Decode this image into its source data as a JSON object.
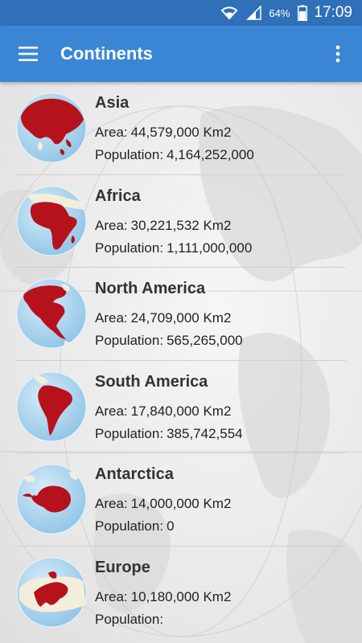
{
  "status_bar": {
    "battery": "64%",
    "time": "17:09",
    "icons": [
      "wifi-icon",
      "signal-icon",
      "battery-icon"
    ]
  },
  "app_bar": {
    "title": "Continents",
    "menu_icon": "hamburger-menu-icon",
    "overflow_icon": "more-vertical-icon",
    "color": "#3a86d4"
  },
  "labels": {
    "area": "Area:",
    "population": "Population:"
  },
  "continents": [
    {
      "name": "Asia",
      "area": "44,579,000 Km2",
      "population": "4,164,252,000"
    },
    {
      "name": "Africa",
      "area": "30,221,532 Km2",
      "population": "1,111,000,000"
    },
    {
      "name": "North America",
      "area": "24,709,000 Km2",
      "population": "565,265,000"
    },
    {
      "name": "South America",
      "area": "17,840,000 Km2",
      "population": "385,742,554"
    },
    {
      "name": "Antarctica",
      "area": "14,000,000 Km2",
      "population": "0"
    },
    {
      "name": "Europe",
      "area": "10,180,000 Km2",
      "population": ""
    }
  ],
  "colors": {
    "highlight": "#b5121b",
    "ocean": "#a9d4ee",
    "land": "#f3eedb"
  }
}
